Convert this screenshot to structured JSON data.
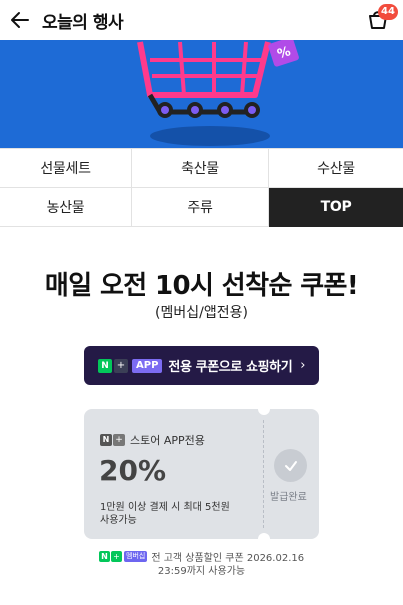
{
  "header": {
    "title": "오늘의 행사",
    "cart_count": "44"
  },
  "categories": [
    {
      "label": "선물세트"
    },
    {
      "label": "축산물"
    },
    {
      "label": "수산물"
    },
    {
      "label": "농산물"
    },
    {
      "label": "주류"
    },
    {
      "label": "TOP"
    }
  ],
  "main": {
    "headline": "매일 오전 10시 선착순 쿠폰!",
    "subheadline": "(멤버십/앱전용)"
  },
  "app_bar": {
    "n_label": "N",
    "plus_label": "+",
    "app_label": "APP",
    "text": "전용 쿠폰으로 쇼핑하기",
    "arrow": "›"
  },
  "coupon": {
    "badge_n": "N",
    "badge_plus": "+",
    "label": "스토어 APP전용",
    "discount": "20%",
    "condition": "1만원 이상 결제 시 최대 5천원",
    "usable": "사용가능",
    "status": "발급완료"
  },
  "footnote": {
    "n_label": "N",
    "plus_label": "+",
    "membership_label": "멤버십",
    "line1": "전 고객 상품할인 쿠폰 2026.02.16",
    "line2": "23:59까지 사용가능"
  },
  "colors": {
    "banner_blue": "#1e6bd6",
    "app_bar_bg": "#241a46",
    "active_tab_bg": "#222222",
    "badge_red": "#f24c3d",
    "naver_green": "#03c75a",
    "coupon_bg": "#dfe2e6"
  },
  "icons": [
    "back-arrow-icon",
    "cart-icon",
    "shopping-cart-illustration",
    "check-icon",
    "chevron-right-icon"
  ]
}
